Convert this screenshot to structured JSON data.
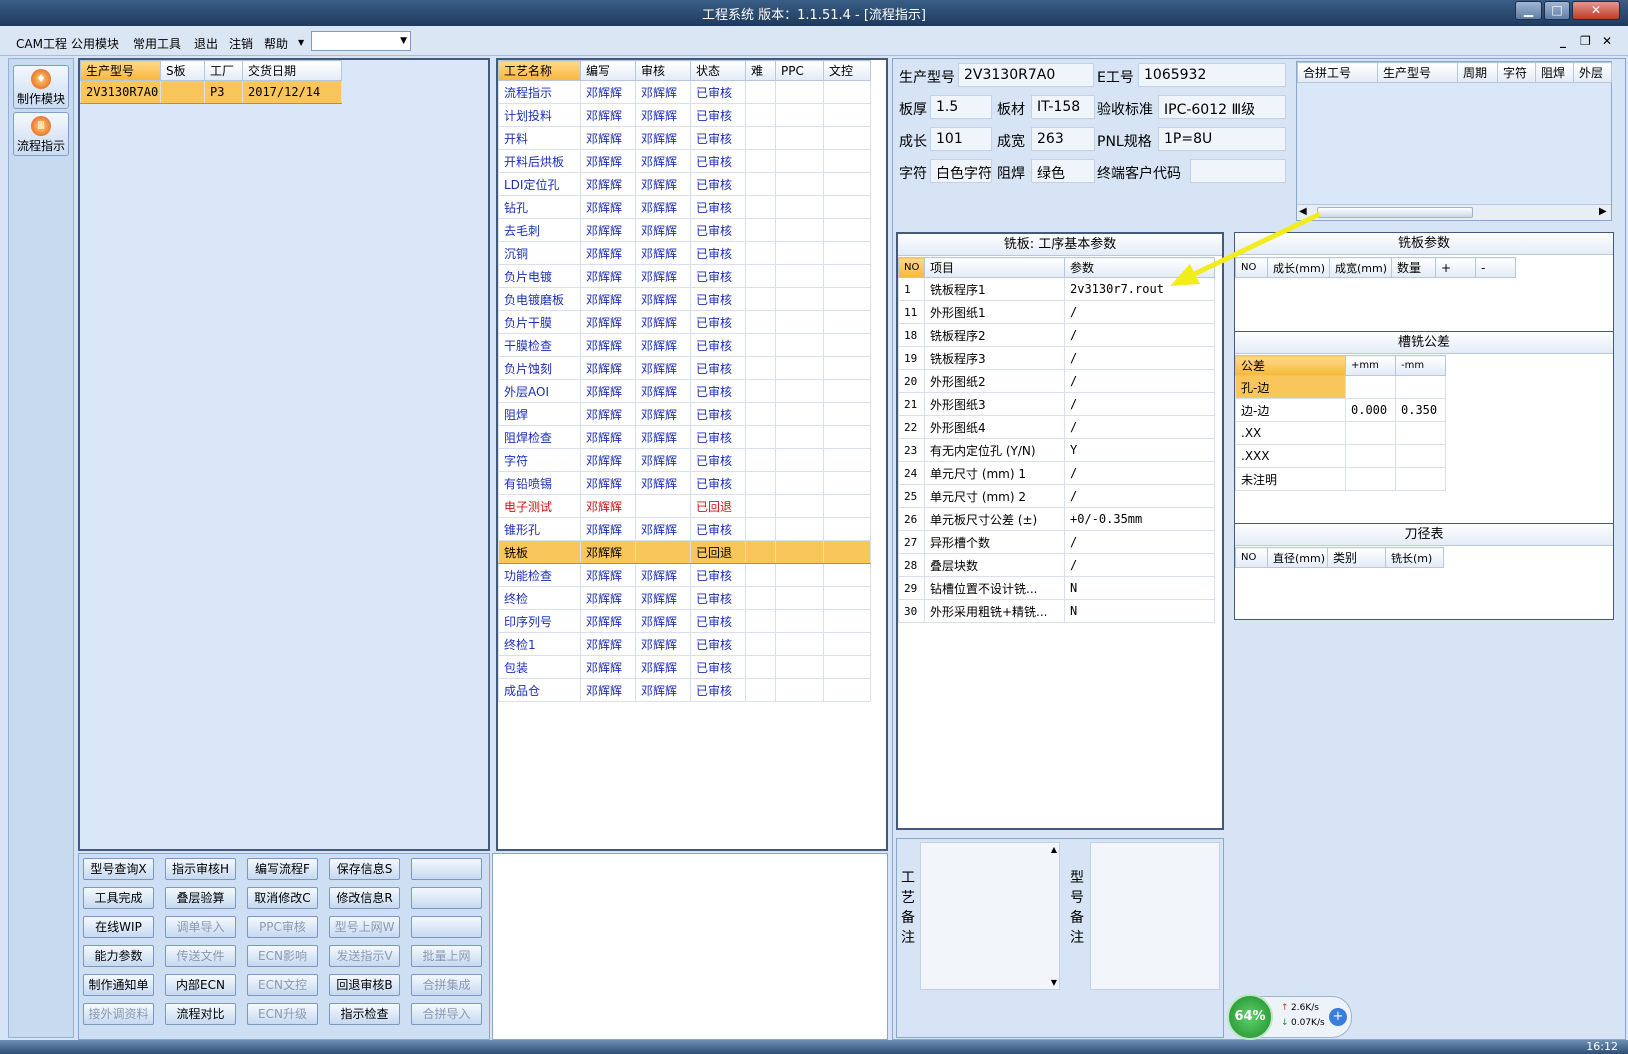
{
  "window": {
    "title": "工程系统   版本：1.1.51.4 - [流程指示]"
  },
  "menu": {
    "items": [
      "CAM工程",
      "公用模块",
      "常用工具",
      "退出",
      "注销",
      "帮助"
    ],
    "combo_value": ""
  },
  "left_bar": {
    "make_module": "制作模块",
    "flow_guide": "流程指示"
  },
  "order_table": {
    "headers": [
      "生产型号",
      "S板",
      "工厂",
      "交货日期"
    ],
    "row": [
      "2V3130R7A0",
      "",
      "P3",
      "2017/12/14"
    ]
  },
  "process_table": {
    "headers": [
      "工艺名称",
      "编写",
      "审核",
      "状态",
      "难",
      "PPC",
      "文控"
    ],
    "rows": [
      [
        "流程指示",
        "邓辉辉",
        "邓辉辉",
        "已审核"
      ],
      [
        "计划投料",
        "邓辉辉",
        "邓辉辉",
        "已审核"
      ],
      [
        "开料",
        "邓辉辉",
        "邓辉辉",
        "已审核"
      ],
      [
        "开料后烘板",
        "邓辉辉",
        "邓辉辉",
        "已审核"
      ],
      [
        "LDI定位孔",
        "邓辉辉",
        "邓辉辉",
        "已审核"
      ],
      [
        "钻孔",
        "邓辉辉",
        "邓辉辉",
        "已审核"
      ],
      [
        "去毛刺",
        "邓辉辉",
        "邓辉辉",
        "已审核"
      ],
      [
        "沉铜",
        "邓辉辉",
        "邓辉辉",
        "已审核"
      ],
      [
        "负片电镀",
        "邓辉辉",
        "邓辉辉",
        "已审核"
      ],
      [
        "负电镀磨板",
        "邓辉辉",
        "邓辉辉",
        "已审核"
      ],
      [
        "负片干膜",
        "邓辉辉",
        "邓辉辉",
        "已审核"
      ],
      [
        "干膜检查",
        "邓辉辉",
        "邓辉辉",
        "已审核"
      ],
      [
        "负片蚀刻",
        "邓辉辉",
        "邓辉辉",
        "已审核"
      ],
      [
        "外层AOI",
        "邓辉辉",
        "邓辉辉",
        "已审核"
      ],
      [
        "阻焊",
        "邓辉辉",
        "邓辉辉",
        "已审核"
      ],
      [
        "阻焊检查",
        "邓辉辉",
        "邓辉辉",
        "已审核"
      ],
      [
        "字符",
        "邓辉辉",
        "邓辉辉",
        "已审核"
      ],
      [
        "有铅喷锡",
        "邓辉辉",
        "邓辉辉",
        "已审核"
      ],
      [
        "电子测试",
        "邓辉辉",
        "",
        "已回退"
      ],
      [
        "锥形孔",
        "邓辉辉",
        "邓辉辉",
        "已审核"
      ],
      [
        "铣板",
        "邓辉辉",
        "",
        "已回退"
      ],
      [
        "功能检查",
        "邓辉辉",
        "邓辉辉",
        "已审核"
      ],
      [
        "终检",
        "邓辉辉",
        "邓辉辉",
        "已审核"
      ],
      [
        "印序列号",
        "邓辉辉",
        "邓辉辉",
        "已审核"
      ],
      [
        "终检1",
        "邓辉辉",
        "邓辉辉",
        "已审核"
      ],
      [
        "包装",
        "邓辉辉",
        "邓辉辉",
        "已审核"
      ],
      [
        "成品仓",
        "邓辉辉",
        "邓辉辉",
        "已审核"
      ]
    ]
  },
  "info": {
    "model_label": "生产型号",
    "model": "2V3130R7A0",
    "eno_label": "E工号",
    "eno": "1065932",
    "thickness_label": "板厚",
    "thickness": "1.5",
    "material_label": "板材",
    "material": "IT-158",
    "standard_label": "验收标准",
    "standard": "IPC-6012 Ⅲ级",
    "length_label": "成长",
    "length": "101",
    "width_label": "成宽",
    "width": "263",
    "pnl_label": "PNL规格",
    "pnl": "1P=8U",
    "char_label": "字符",
    "char": "白色字符",
    "mask_label": "阻焊",
    "mask": "绿色",
    "customer_label": "终端客户代码",
    "customer": ""
  },
  "merge_table": {
    "headers": [
      "合拼工号",
      "生产型号",
      "周期",
      "字符",
      "阻焊",
      "外层"
    ]
  },
  "params": {
    "title": "铣板: 工序基本参数",
    "headers": [
      "NO",
      "项目",
      "参数"
    ],
    "rows": [
      [
        "1",
        "铣板程序1",
        "2v3130r7.rout"
      ],
      [
        "11",
        "外形图纸1",
        "/"
      ],
      [
        "18",
        "铣板程序2",
        "/"
      ],
      [
        "19",
        "铣板程序3",
        "/"
      ],
      [
        "20",
        "外形图纸2",
        "/"
      ],
      [
        "21",
        "外形图纸3",
        "/"
      ],
      [
        "22",
        "外形图纸4",
        "/"
      ],
      [
        "23",
        "有无内定位孔 (Y/N)",
        "Y"
      ],
      [
        "24",
        "单元尺寸 (mm) 1",
        "/"
      ],
      [
        "25",
        "单元尺寸 (mm) 2",
        "/"
      ],
      [
        "26",
        "单元板尺寸公差 (±)",
        "+0/-0.35mm"
      ],
      [
        "27",
        "异形槽个数",
        "/"
      ],
      [
        "28",
        "叠层块数",
        "/"
      ],
      [
        "29",
        "钻槽位置不设计铣...",
        "N"
      ],
      [
        "30",
        "外形采用粗铣+精铣...",
        "N"
      ]
    ]
  },
  "mill_params": {
    "title": "铣板参数",
    "headers": [
      "NO",
      "成长(mm)",
      "成宽(mm)",
      "数量",
      "+",
      "-"
    ]
  },
  "slot_tol": {
    "title": "槽铣公差",
    "headers": [
      "公差",
      "+mm",
      "-mm"
    ],
    "rows": [
      [
        "孔-边",
        "",
        ""
      ],
      [
        "边-边",
        "0.000",
        "0.350"
      ],
      [
        ".XX",
        "",
        ""
      ],
      [
        ".XXX",
        "",
        ""
      ],
      [
        "未注明",
        "",
        ""
      ]
    ]
  },
  "tool_table": {
    "title": "刀径表",
    "headers": [
      "NO",
      "直径(mm)",
      "类别",
      "铣长(m)"
    ]
  },
  "notes": {
    "process_note": "工艺备注",
    "model_note": "型号备注"
  },
  "buttons": [
    [
      "型号查询X",
      "指示审核H",
      "编写流程F",
      "保存信息S",
      ""
    ],
    [
      "工具完成",
      "叠层验算",
      "取消修改C",
      "修改信息R",
      ""
    ],
    [
      "在线WIP",
      "调单导入",
      "PPC审核",
      "型号上网W",
      ""
    ],
    [
      "能力参数",
      "传送文件",
      "ECN影响",
      "发送指示V",
      "批量上网"
    ],
    [
      "制作通知单",
      "内部ECN",
      "ECN文控",
      "回退审核B",
      "合拼集成"
    ],
    [
      "接外调资料",
      "流程对比",
      "ECN升级",
      "指示检查",
      "合拼导入"
    ]
  ],
  "disabled_buttons": [
    "调单导入",
    "PPC审核",
    "型号上网W",
    "传送文件",
    "ECN影响",
    "发送指示V",
    "批量上网",
    "ECN文控",
    "合拼集成",
    "接外调资料",
    "ECN升级",
    "合拼导入"
  ],
  "net_widget": {
    "percent": "64%",
    "up": "2.6K/s",
    "down": "0.07K/s"
  },
  "clock": "16:12",
  "colors": {
    "selected_row": "#f9c65b",
    "approved": "#1d2eb8",
    "rejected": "#d21414",
    "arrow": "#f2ec1f"
  }
}
